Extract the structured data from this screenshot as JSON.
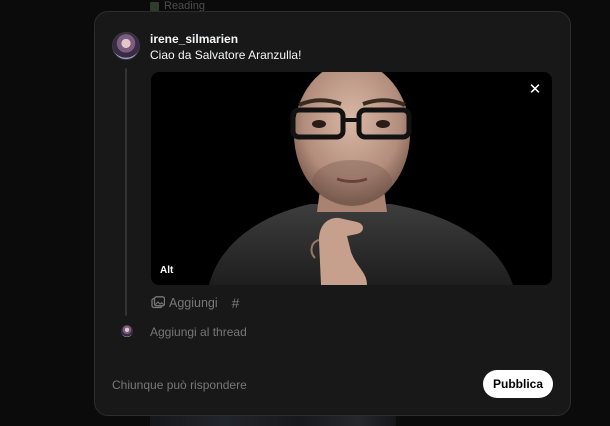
{
  "background": {
    "reading_label": "Reading"
  },
  "composer": {
    "username": "irene_silmarien",
    "text": "Ciao da Salvatore Aranzulla!",
    "media": {
      "alt_label": "Alt",
      "close_symbol": "✕"
    },
    "toolbar": {
      "add_media_label": "Aggiungi",
      "add_media_icon": "image-plus-icon",
      "hashtag_symbol": "#"
    },
    "add_to_thread_label": "Aggiungi al thread",
    "reply_setting_label": "Chiunque può rispondere",
    "publish_label": "Pubblica"
  },
  "colors": {
    "modal_bg": "#181818",
    "primary_text": "#f3f5f7",
    "secondary_text": "#777777",
    "publish_bg": "#ffffff"
  }
}
